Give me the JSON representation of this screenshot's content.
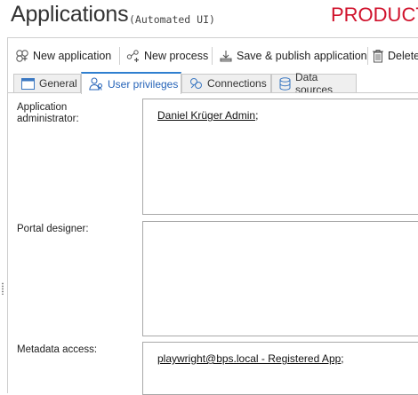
{
  "header": {
    "title": "Applications",
    "subtitle": "(Automated UI)",
    "environment": "PRODUCT"
  },
  "toolbar": {
    "new_application": "New application",
    "new_process": "New process",
    "save_publish": "Save & publish application",
    "delete": "Delete"
  },
  "tabs": [
    {
      "label": "General",
      "icon": "window-icon"
    },
    {
      "label": "User privileges",
      "icon": "users-icon",
      "active": true
    },
    {
      "label": "Connections",
      "icon": "connections-icon"
    },
    {
      "label": "Data sources",
      "icon": "database-icon"
    }
  ],
  "privileges": {
    "app_admin": {
      "label": "Application administrator:",
      "user": "Daniel Krüger Admin",
      "sep": ";"
    },
    "portal_designer": {
      "label": "Portal designer:"
    },
    "metadata_access": {
      "label": "Metadata access:",
      "user": "playwright@bps.local - Registered App",
      "sep": ";"
    }
  },
  "colors": {
    "environment": "#d0112b",
    "active_tab": "#2f7fd0"
  }
}
